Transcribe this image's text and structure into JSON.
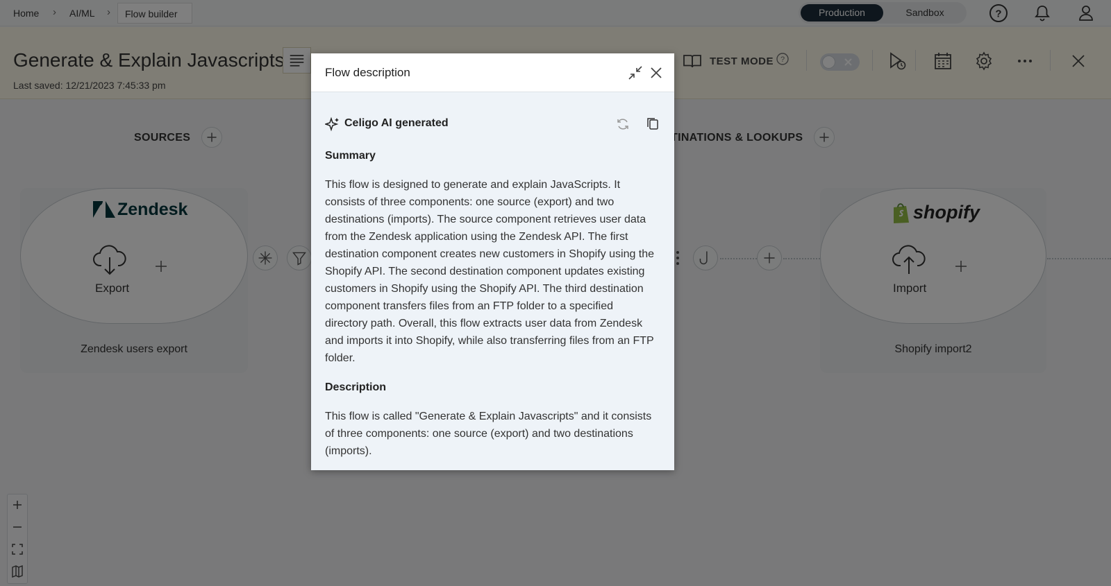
{
  "breadcrumb": {
    "items": [
      "Home",
      "AI/ML"
    ],
    "current": "Flow builder"
  },
  "environment": {
    "production_label": "Production",
    "sandbox_label": "Sandbox"
  },
  "flow": {
    "title": "Generate & Explain Javascripts",
    "last_saved": "Last saved: 12/21/2023 7:45:33 pm",
    "test_mode_label": "TEST MODE"
  },
  "canvas": {
    "sources_label": "SOURCES",
    "destinations_label": "TINATIONS & LOOKUPS",
    "source_card": {
      "brand": "Zendesk",
      "component_label": "Export",
      "name": "Zendesk users export"
    },
    "destination_card": {
      "brand": "shopify",
      "component_label": "Import",
      "name": "Shopify import2"
    }
  },
  "modal": {
    "title": "Flow description",
    "ai_label": "Celigo AI generated",
    "summary_heading": "Summary",
    "summary_text": "This flow is designed to generate and explain JavaScripts. It consists of three components: one source (export) and two destinations (imports). The source component retrieves user data from the Zendesk application using the Zendesk API. The first destination component creates new customers in Shopify using the Shopify API. The second destination component updates existing customers in Shopify using the Shopify API. The third destination component transfers files from an FTP folder to a specified directory path. Overall, this flow extracts user data from Zendesk and imports it into Shopify, while also transferring files from an FTP folder.",
    "description_heading": "Description",
    "description_text": "This flow is called \"Generate & Explain Javascripts\" and it consists of three components: one source (export) and two destinations (imports)."
  },
  "colors": {
    "accent_dark": "#1d2d3a",
    "header_bg": "#fffbea",
    "modal_bg": "#eef3f8",
    "shopify_green": "#95bf47"
  }
}
